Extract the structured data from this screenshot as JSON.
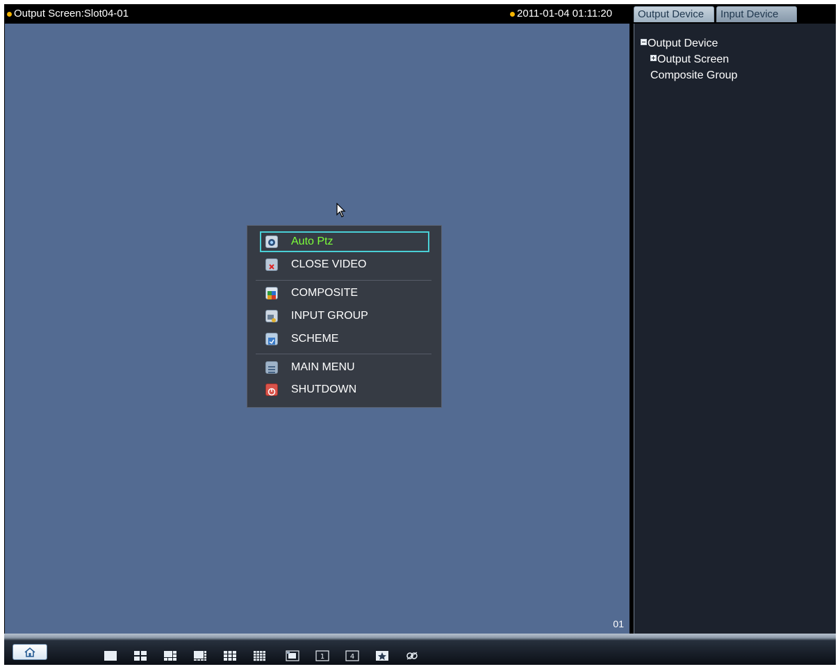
{
  "top_bar": {
    "screen_title": "Output Screen:Slot04-01",
    "datetime": "2011-01-04 01:11:20",
    "tabs": [
      {
        "label": "Output Device"
      },
      {
        "label": "Input Device"
      }
    ]
  },
  "video": {
    "channel_number": "01"
  },
  "context_menu": {
    "items": [
      {
        "label": "Auto Ptz"
      },
      {
        "label": "CLOSE VIDEO"
      },
      {
        "label": "COMPOSITE"
      },
      {
        "label": "INPUT GROUP"
      },
      {
        "label": "SCHEME"
      },
      {
        "label": "MAIN MENU"
      },
      {
        "label": "SHUTDOWN"
      }
    ]
  },
  "device_tree": {
    "root": "Output Device",
    "children": [
      {
        "label": "Output Screen"
      },
      {
        "label": "Composite Group"
      }
    ]
  },
  "bottom_bar": {
    "home_icon": "home-icon",
    "layout_buttons": [
      "layout-1-icon",
      "layout-4-icon",
      "layout-6-icon",
      "layout-8-icon",
      "layout-9-icon",
      "layout-16-icon",
      "layout-pip-icon",
      "sequence-1-icon",
      "sequence-4-icon",
      "favorite-icon",
      "link-icon"
    ]
  },
  "colors": {
    "video_bg": "#536b92",
    "panel_bg": "#1c222d",
    "menu_bg": "#363b44",
    "selected_text": "#7cff3a",
    "selection_border": "#4ad0d6",
    "status_dot": "#f5b400"
  }
}
